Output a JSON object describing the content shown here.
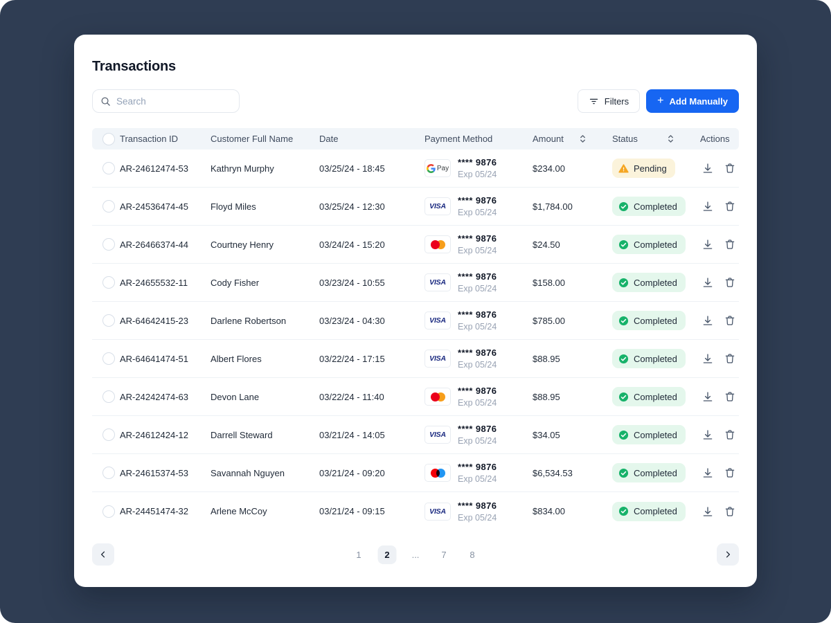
{
  "page": {
    "title": "Transactions",
    "background_color": "#2F3D53",
    "accent_color": "#1766F2"
  },
  "toolbar": {
    "search_placeholder": "Search",
    "filters_label": "Filters",
    "add_plus": "+",
    "add_manually_label": "Add Manually"
  },
  "table": {
    "columns": [
      "Transaction ID",
      "Customer Full Name",
      "Date",
      "Payment Method",
      "Amount",
      "Status",
      "Actions"
    ],
    "rows": [
      {
        "id": "AR-24612474-53",
        "name": "Kathryn Murphy",
        "date": "03/25/24 - 18:45",
        "card": "gpay",
        "card_number": "**** 9876",
        "card_exp": "Exp 05/24",
        "amount": "$234.00",
        "status": "Pending"
      },
      {
        "id": "AR-24536474-45",
        "name": "Floyd Miles",
        "date": "03/25/24 - 12:30",
        "card": "visa",
        "card_number": "**** 9876",
        "card_exp": "Exp 05/24",
        "amount": "$1,784.00",
        "status": "Completed"
      },
      {
        "id": "AR-26466374-44",
        "name": "Courtney Henry",
        "date": "03/24/24 - 15:20",
        "card": "mastercard",
        "card_number": "**** 9876",
        "card_exp": "Exp 05/24",
        "amount": "$24.50",
        "status": "Completed"
      },
      {
        "id": "AR-24655532-11",
        "name": "Cody Fisher",
        "date": "03/23/24 - 10:55",
        "card": "visa",
        "card_number": "**** 9876",
        "card_exp": "Exp 05/24",
        "amount": "$158.00",
        "status": "Completed"
      },
      {
        "id": "AR-64642415-23",
        "name": "Darlene Robertson",
        "date": "03/23/24 - 04:30",
        "card": "visa",
        "card_number": "**** 9876",
        "card_exp": "Exp 05/24",
        "amount": "$785.00",
        "status": "Completed"
      },
      {
        "id": "AR-64641474-51",
        "name": "Albert Flores",
        "date": "03/22/24 - 17:15",
        "card": "visa",
        "card_number": "**** 9876",
        "card_exp": "Exp 05/24",
        "amount": "$88.95",
        "status": "Completed"
      },
      {
        "id": "AR-24242474-63",
        "name": "Devon Lane",
        "date": "03/22/24 - 11:40",
        "card": "mastercard",
        "card_number": "**** 9876",
        "card_exp": "Exp 05/24",
        "amount": "$88.95",
        "status": "Completed"
      },
      {
        "id": "AR-24612424-12",
        "name": "Darrell Steward",
        "date": "03/21/24 - 14:05",
        "card": "visa",
        "card_number": "**** 9876",
        "card_exp": "Exp 05/24",
        "amount": "$34.05",
        "status": "Completed"
      },
      {
        "id": "AR-24615374-53",
        "name": "Savannah Nguyen",
        "date": "03/21/24 - 09:20",
        "card": "redblue",
        "card_number": "**** 9876",
        "card_exp": "Exp 05/24",
        "amount": "$6,534.53",
        "status": "Completed"
      },
      {
        "id": "AR-24451474-32",
        "name": "Arlene McCoy",
        "date": "03/21/24 - 09:15",
        "card": "visa",
        "card_number": "**** 9876",
        "card_exp": "Exp 05/24",
        "amount": "$834.00",
        "status": "Completed"
      }
    ]
  },
  "payment": {
    "brand_labels": {
      "visa": "VISA",
      "gpay_pay": "Pay"
    },
    "brand_colors": {
      "mastercard_left": "#EB001B",
      "mastercard_right": "#F79E1B",
      "redblue_left": "#F40009",
      "redblue_right": "#2196F3"
    }
  },
  "status": {
    "pending": {
      "label": "Pending",
      "bg": "#FBF3DB",
      "icon_color": "#F5A623"
    },
    "completed": {
      "label": "Completed",
      "bg": "#E4F7EC",
      "icon_color": "#17B26A"
    }
  },
  "pagination": {
    "pages": [
      "1",
      "2",
      "...",
      "7",
      "8"
    ],
    "active_page": "2"
  }
}
